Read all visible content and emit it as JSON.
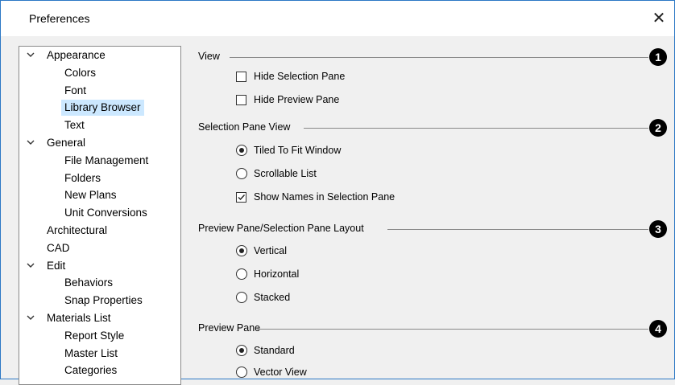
{
  "window": {
    "title": "Preferences",
    "close_glyph": "✕"
  },
  "tree": [
    {
      "label": "Appearance",
      "level": 0,
      "expanded": true
    },
    {
      "label": "Colors",
      "level": 1
    },
    {
      "label": "Font",
      "level": 1
    },
    {
      "label": "Library Browser",
      "level": 1,
      "selected": true
    },
    {
      "label": "Text",
      "level": 1
    },
    {
      "label": "General",
      "level": 0,
      "expanded": true
    },
    {
      "label": "File Management",
      "level": 1
    },
    {
      "label": "Folders",
      "level": 1
    },
    {
      "label": "New Plans",
      "level": 1
    },
    {
      "label": "Unit Conversions",
      "level": 1
    },
    {
      "label": "Architectural",
      "level": 0
    },
    {
      "label": "CAD",
      "level": 0
    },
    {
      "label": "Edit",
      "level": 0,
      "expanded": true
    },
    {
      "label": "Behaviors",
      "level": 1
    },
    {
      "label": "Snap Properties",
      "level": 1
    },
    {
      "label": "Materials List",
      "level": 0,
      "expanded": true
    },
    {
      "label": "Report Style",
      "level": 1
    },
    {
      "label": "Master List",
      "level": 1
    },
    {
      "label": "Categories",
      "level": 1
    }
  ],
  "sections": {
    "view": {
      "title": "View",
      "badge": "1",
      "hide_selection_pane": {
        "label": "Hide Selection Pane",
        "checked": false
      },
      "hide_preview_pane": {
        "label": "Hide Preview Pane",
        "checked": false
      }
    },
    "selection_pane_view": {
      "title": "Selection Pane View",
      "badge": "2",
      "tiled": {
        "label": "Tiled To Fit Window",
        "selected": true
      },
      "scrollable": {
        "label": "Scrollable List",
        "selected": false
      },
      "show_names": {
        "label": "Show Names in Selection Pane",
        "checked": true
      }
    },
    "layout": {
      "title": "Preview Pane/Selection Pane Layout",
      "badge": "3",
      "vertical": {
        "label": "Vertical",
        "selected": true
      },
      "horizontal": {
        "label": "Horizontal",
        "selected": false
      },
      "stacked": {
        "label": "Stacked",
        "selected": false
      }
    },
    "preview_pane": {
      "title": "Preview Pane",
      "badge": "4",
      "standard": {
        "label": "Standard",
        "selected": true
      },
      "vector": {
        "label": "Vector View",
        "selected": false
      }
    }
  }
}
